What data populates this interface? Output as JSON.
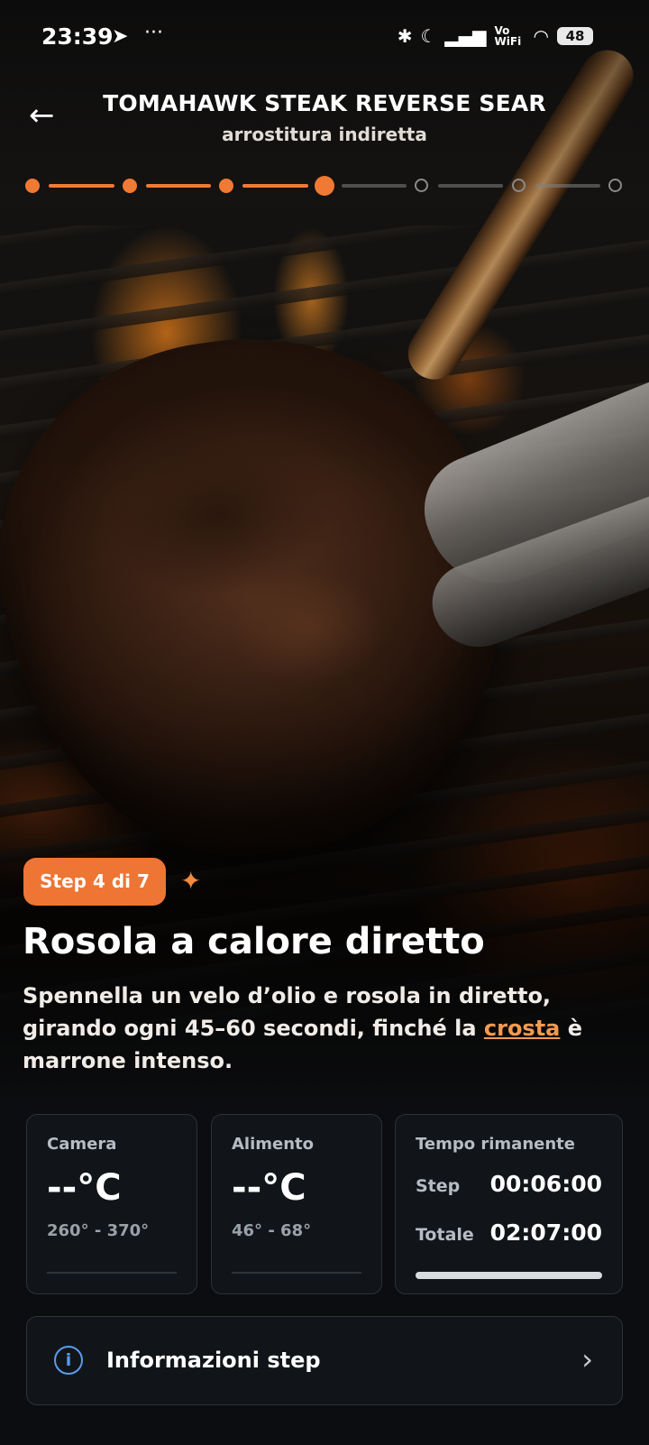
{
  "status_bar": {
    "time": "23:39",
    "telegram_icon": "telegram-icon",
    "more": "···",
    "network": "Vo WiFi",
    "battery": "48"
  },
  "header": {
    "title": "TOMAHAWK STEAK REVERSE SEAR",
    "subtitle": "arrostitura indiretta"
  },
  "progress": {
    "current_step": 4,
    "total_steps": 7
  },
  "step": {
    "badge": "Step 4 di 7",
    "title": "Rosola a calore diretto",
    "desc_before": "Spennella un velo d’olio e rosola in diretto, girando ogni 45–60 secondi, finché la ",
    "desc_link": "crosta",
    "desc_after": " è marrone intenso."
  },
  "cards": {
    "camera": {
      "label": "Camera",
      "value": "--°C",
      "range": "260° - 370°"
    },
    "alimento": {
      "label": "Alimento",
      "value": "--°C",
      "range": "46° - 68°"
    },
    "tempo": {
      "label": "Tempo rimanente",
      "step_label": "Step",
      "step_value": "00:06:00",
      "total_label": "Totale",
      "total_value": "02:07:00",
      "progress": 1.0
    }
  },
  "info": {
    "label": "Informazioni step"
  },
  "colors": {
    "accent": "#ee7534",
    "info_icon": "#5a9cf0",
    "card_bg": "#111519"
  }
}
